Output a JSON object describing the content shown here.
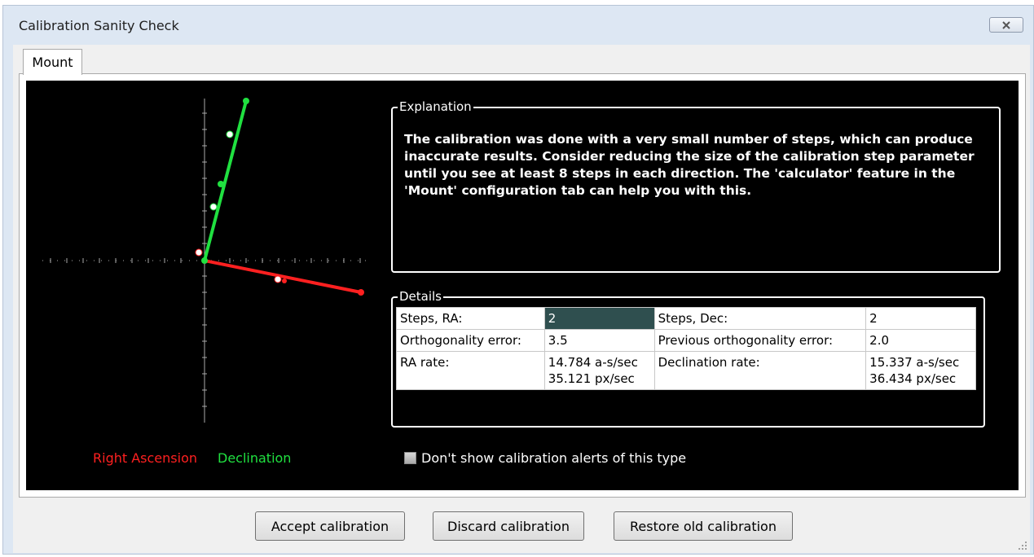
{
  "window": {
    "title": "Calibration Sanity Check",
    "close_icon": "close-icon"
  },
  "tabs": [
    {
      "label": "Mount",
      "selected": true
    }
  ],
  "legend": {
    "ra_label": "Right Ascension",
    "dec_label": "Declination",
    "ra_color": "#ff2020",
    "dec_color": "#20e040"
  },
  "explanation": {
    "title": "Explanation",
    "text": "The calibration was done with a very small number of steps, which can produce inaccurate results. Consider reducing the size of the calibration step parameter until you see at least 8 steps in each direction.  The 'calculator' feature in the 'Mount' configuration tab can help you with this."
  },
  "details": {
    "title": "Details",
    "rows": [
      {
        "label1": "Steps, RA:",
        "value1": "2",
        "label2": "Steps, Dec:",
        "value2": "2"
      },
      {
        "label1": "Orthogonality error:",
        "value1": "3.5",
        "label2": "Previous orthogonality error:",
        "value2": "2.0"
      },
      {
        "label1": "RA rate:",
        "value1a": "14.784 a-s/sec",
        "value1b": "35.121 px/sec",
        "label2": "Declination rate:",
        "value2a": "15.337 a-s/sec",
        "value2b": "36.434 px/sec"
      }
    ]
  },
  "checkbox": {
    "label": "Don't show calibration alerts of this type",
    "checked": false
  },
  "buttons": {
    "accept": "Accept calibration",
    "discard": "Discard calibration",
    "restore": "Restore old calibration"
  }
}
